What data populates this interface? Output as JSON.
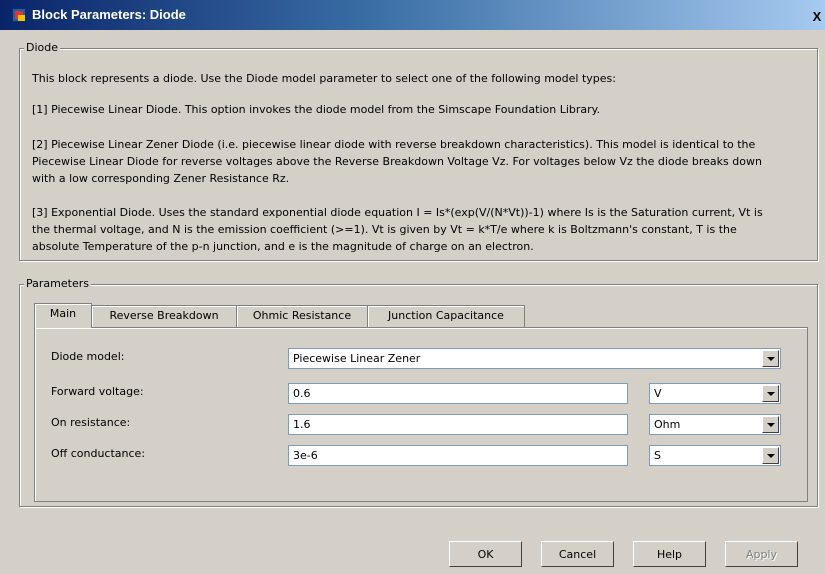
{
  "window": {
    "title": "Block Parameters: Diode",
    "close_label": "X"
  },
  "description_group": {
    "legend": "Diode",
    "lines": [
      "This block represents a diode. Use the Diode model parameter to select one of the following model types:",
      "[1] Piecewise Linear Diode. This option invokes the diode model from the Simscape Foundation Library.",
      "[2] Piecewise Linear Zener Diode (i.e. piecewise linear diode with reverse breakdown characteristics). This model is identical to the",
      "Piecewise Linear Diode for reverse voltages above the Reverse Breakdown Voltage Vz. For voltages below Vz the diode breaks down",
      "with a low corresponding Zener Resistance Rz.",
      "[3] Exponential Diode. Uses the standard exponential diode equation I = Is*(exp(V/(N*Vt))-1) where Is is the Saturation current, Vt is",
      "the thermal voltage, and N is the emission coefficient (>=1). Vt is given by Vt = k*T/e where k is Boltzmann's constant, T is the",
      "absolute Temperature of the p-n junction, and e is the magnitude of charge on an electron."
    ]
  },
  "parameters_group": {
    "legend": "Parameters",
    "tabs": [
      "Main",
      "Reverse Breakdown",
      "Ohmic Resistance",
      "Junction Capacitance"
    ],
    "active_tab": "Main",
    "rows": {
      "diode_model": {
        "label": "Diode model:",
        "value": "Piecewise Linear Zener"
      },
      "forward_voltage": {
        "label": "Forward voltage:",
        "value": "0.6",
        "unit": "V"
      },
      "on_resistance": {
        "label": "On resistance:",
        "value": "1.6",
        "unit": "Ohm"
      },
      "off_conductance": {
        "label": "Off conductance:",
        "value": "3e-6",
        "unit": "S"
      }
    }
  },
  "buttons": {
    "ok": "OK",
    "cancel": "Cancel",
    "help": "Help",
    "apply": "Apply",
    "apply_enabled": false
  },
  "icons": {
    "app": "simulink-block-icon",
    "dropdown": "chevron-down-icon"
  },
  "colors": {
    "titlebar_start": "#0a246a",
    "titlebar_end": "#a6caf0",
    "dialog_bg": "#d4d0c8",
    "field_border": "#7f9db9"
  }
}
